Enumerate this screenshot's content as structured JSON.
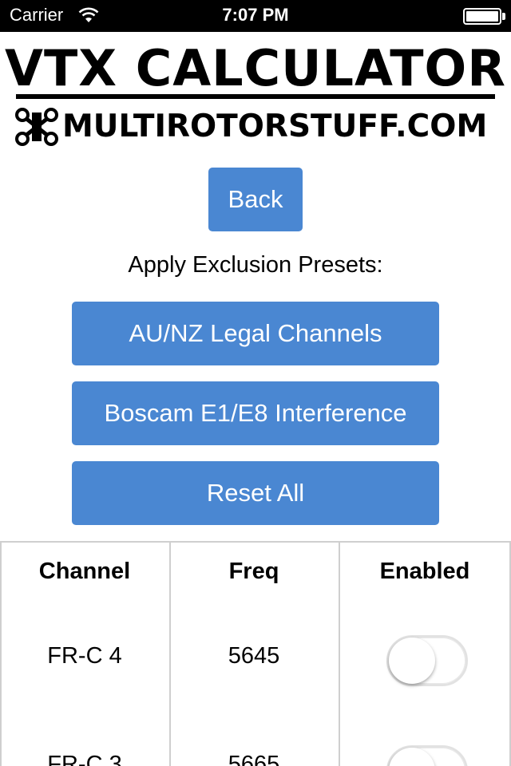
{
  "status_bar": {
    "carrier": "Carrier",
    "time": "7:07 PM",
    "wifi_icon": "wifi-icon",
    "battery_icon": "battery-icon"
  },
  "logo": {
    "title": "VTX CALCULATOR",
    "site": "MULTIROTORSTUFF.COM",
    "icon": "drone-icon"
  },
  "nav": {
    "back_label": "Back"
  },
  "presets": {
    "label": "Apply Exclusion Presets:",
    "buttons": [
      "AU/NZ Legal Channels",
      "Boscam E1/E8 Interference",
      "Reset All"
    ]
  },
  "table": {
    "headers": [
      "Channel",
      "Freq",
      "Enabled"
    ],
    "rows": [
      {
        "channel": "FR-C 4",
        "freq": "5645",
        "enabled": false
      },
      {
        "channel": "FR-C 3",
        "freq": "5665",
        "enabled": false
      }
    ]
  },
  "colors": {
    "button": "#4a87d2",
    "status_bar": "#000000",
    "toggle_off": "#e2e2e2"
  }
}
